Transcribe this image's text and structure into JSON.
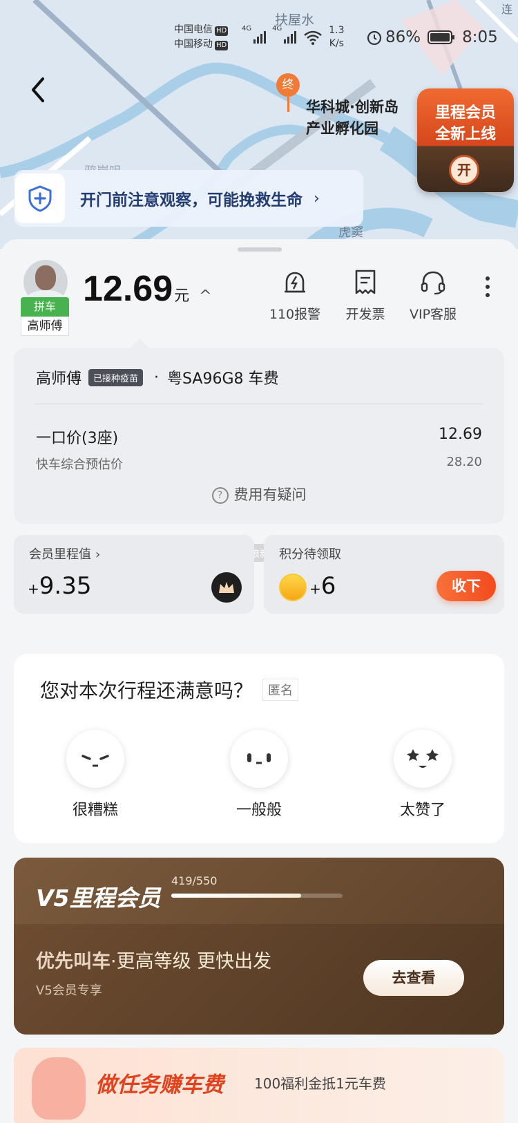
{
  "status_bar": {
    "carrier1": "中国电信",
    "carrier2": "中国移动",
    "hd": "HD",
    "net1": "4G",
    "net2": "4G",
    "speed": "1.3\nK/s",
    "battery": "86%",
    "time": "8:05"
  },
  "map": {
    "labels": [
      "扶屋水",
      "鸦岗咀",
      "虎窦",
      "连"
    ],
    "destination_marker": "终",
    "destination": "华科城·创新岛\n产业孵化园"
  },
  "promo": {
    "title": "里程会员\n全新上线",
    "button": "开"
  },
  "safety": {
    "text": "开门前注意观察，可能挽救生命",
    "icon": "shield-plus-icon"
  },
  "driver": {
    "tag": "拼车",
    "name": "高师傅"
  },
  "fare": {
    "amount": "12.69",
    "unit": "元",
    "driver_name": "高师傅",
    "vaccine_badge": "已接种疫苗",
    "separator": "·",
    "plate": "粤SA96G8 车费",
    "line1_label": "一口价(3座)",
    "line1_value": "12.69",
    "line2_label": "快车综合预估价",
    "line2_value": "28.20",
    "question": "费用有疑问"
  },
  "actions": [
    {
      "label": "110报警",
      "icon": "alarm-icon"
    },
    {
      "label": "开发票",
      "icon": "invoice-icon"
    },
    {
      "label": "VIP客服",
      "icon": "headset-icon"
    }
  ],
  "watermark": "新浪新闻 @ 新浪科技",
  "mileage_card": {
    "label": "会员里程值",
    "plus": "+",
    "value": "9.35"
  },
  "points_card": {
    "label": "积分待领取",
    "plus": "+",
    "value": "6",
    "button": "收下"
  },
  "rating": {
    "question": "您对本次行程还满意吗？",
    "anonymous": "匿名",
    "options": [
      "很糟糕",
      "一般般",
      "太赞了"
    ]
  },
  "vip_card": {
    "title": "V5里程会员",
    "progress_text": "419/550",
    "progress": 0.76,
    "slogan_a": "优先叫车",
    "slogan_b": "·更高等级 更快出发",
    "sub": "V5会员专享",
    "button": "去查看"
  },
  "task": {
    "title": "做任务赚车费",
    "desc": "100福利金抵1元车费"
  },
  "colors": {
    "accent": "#f34a1e",
    "driver_tag": "#47b24e",
    "nav_text": "#243d70"
  }
}
